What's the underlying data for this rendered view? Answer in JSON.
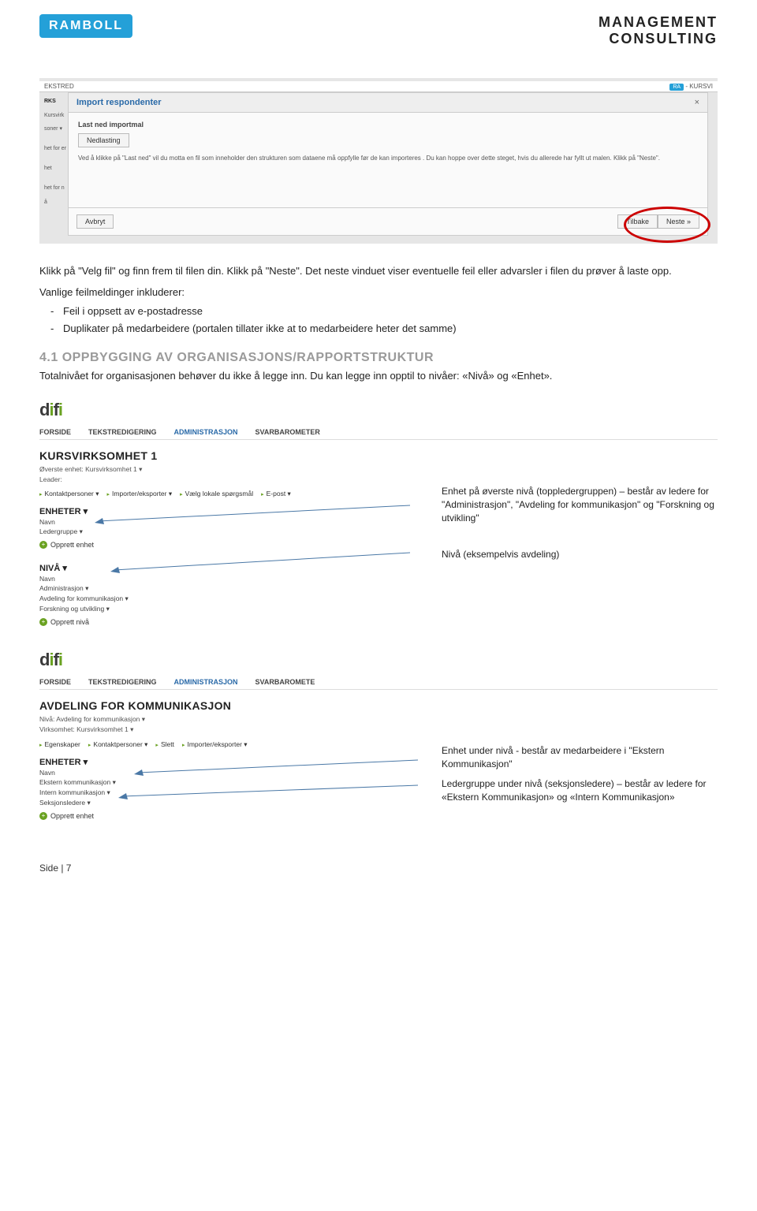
{
  "header": {
    "ramboll": "RAMBOLL",
    "mgmt1": "MANAGEMENT",
    "mgmt2": "CONSULTING"
  },
  "shot1": {
    "topstrip_left": "EKSTRED",
    "topstrip_right_tag": "RA",
    "topstrip_right_text": " - KURSVI",
    "dialog_title": "Import respondenter",
    "dialog_close": "×",
    "section_label": "Last ned importmal",
    "nedlasting": "Nedlasting",
    "hint": "Ved å klikke på \"Last ned\" vil du motta en fil som inneholder den strukturen som dataene må oppfylle før de kan importeres . Du kan hoppe over dette steget, hvis du allerede har fyllt ut malen. Klikk på \"Neste\".",
    "avbryt": "Avbryt",
    "tilbake": "Tilbake",
    "neste": "Neste »",
    "left_rks": "RKS",
    "left_kursv": "Kursvirk",
    "left_soner": "soner ▾",
    "left_hetfor": "het for er",
    "left_het": "het",
    "left_hetforn": "het for n",
    "left_a": "å"
  },
  "para": {
    "p1": "Klikk på \"Velg fil\" og finn frem til filen din. Klikk på \"Neste\". Det neste vinduet viser eventuelle feil eller advarsler i filen du prøver å laste opp.",
    "p2": "Vanlige feilmeldinger inkluderer:",
    "b1": "Feil i oppsett av e-postadresse",
    "b2": "Duplikater på medarbeidere (portalen tillater ikke at to medarbeidere heter det samme)"
  },
  "h2": "4.1 OPPBYGGING AV ORGANISASJONS/RAPPORTSTRUKTUR",
  "h2desc": "Totalnivået for organisasjonen behøver du ikke å legge inn. Du kan legge inn opptil to nivåer: «Nivå» og «Enhet».",
  "menu": {
    "forside": "FORSIDE",
    "tekstred": "TEKSTREDIGERING",
    "admin": "ADMINISTRASJON",
    "svar": "SVARBAROMETER",
    "svar2": "SVARBAROMETE"
  },
  "shot2": {
    "title": "KURSVIRKSOMHET 1",
    "meta1": "Øverste enhet: Kursvirksomhet 1  ▾",
    "meta2": "Leader:",
    "tb_kontakt": "Kontaktpersoner ▾",
    "tb_import": "Importer/eksporter ▾",
    "tb_vaelg": "Vælg lokale spørgsmål",
    "tb_epost": "E-post ▾",
    "enheter_head": "ENHETER  ▾",
    "navn": "Navn",
    "ledergruppe": "Ledergruppe  ▾",
    "opprett_enhet": "Opprett enhet",
    "nivaa_head": "NIVÅ  ▾",
    "nivaa_navn": "Navn",
    "n_admin": "Administrasjon  ▾",
    "n_avd": "Avdeling for kommunikasjon  ▾",
    "n_fors": "Forskning og utvikling  ▾",
    "opprett_nivaa": "Opprett nivå"
  },
  "callouts2": {
    "enhet": "Enhet på øverste nivå (toppledergruppen) – består av ledere for \"Administrasjon\", \"Avdeling for kommunikasjon\" og \"Forskning og utvikling\"",
    "nivaa": "Nivå (eksempelvis avdeling)"
  },
  "shot3": {
    "title": "AVDELING FOR KOMMUNIKASJON",
    "meta1": "Nivå: Avdeling for kommunikasjon  ▾",
    "meta2": "Virksomhet: Kursvirksomhet 1  ▾",
    "tb_egenskaper": "Egenskaper",
    "tb_kontakt": "Kontaktpersoner ▾",
    "tb_slett": "Slett",
    "tb_import": "Importer/eksporter ▾",
    "enheter_head": "ENHETER  ▾",
    "navn": "Navn",
    "r1": "Ekstern kommunikasjon  ▾",
    "r2": "Intern kommunikasjon  ▾",
    "r3": "Seksjonsledere  ▾",
    "opprett_enhet": "Opprett enhet"
  },
  "callouts3": {
    "enhet": "Enhet under nivå - består av medarbeidere i \"Ekstern Kommunikasjon\"",
    "ledergruppe": "Ledergruppe under nivå (seksjonsledere) – består av ledere for «Ekstern Kommunikasjon» og «Intern Kommunikasjon»"
  },
  "footer": "Side | 7"
}
